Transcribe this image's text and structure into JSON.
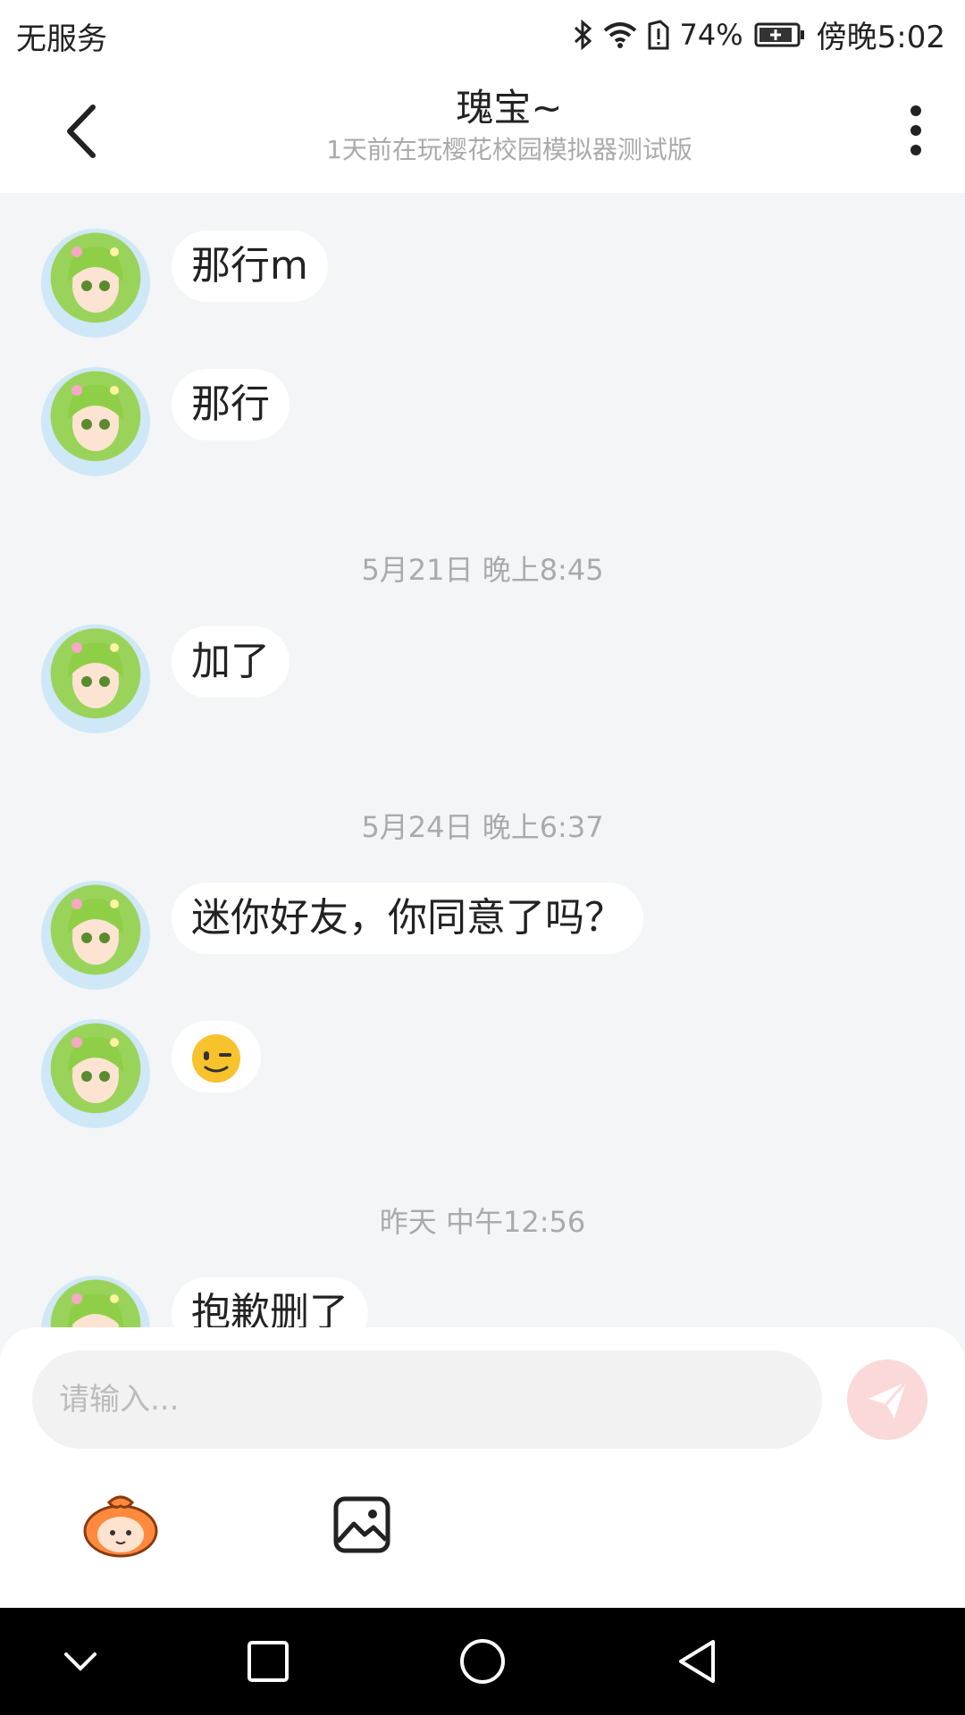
{
  "status_bar": {
    "carrier": "无服务",
    "battery_percent": "74%",
    "time": "傍晚5:02",
    "icons": [
      "bluetooth-icon",
      "wifi-icon",
      "sim-alert-icon",
      "battery-charging-icon"
    ]
  },
  "header": {
    "title": "瑰宝~",
    "subtitle": "1天前在玩樱花校园模拟器测试版"
  },
  "messages": [
    {
      "type": "text",
      "text": "那行m"
    },
    {
      "type": "text",
      "text": "那行"
    },
    {
      "type": "time",
      "text": "5月21日 晚上8:45"
    },
    {
      "type": "text",
      "text": "加了"
    },
    {
      "type": "time",
      "text": "5月24日 晚上6:37"
    },
    {
      "type": "text",
      "text": "迷你好友，你同意了吗？"
    },
    {
      "type": "emoji",
      "emoji": "wink-emoji"
    },
    {
      "type": "time",
      "text": "昨天 中午12:56"
    },
    {
      "type": "text",
      "text": "抱歉删了"
    }
  ],
  "input": {
    "placeholder": "请输入..."
  },
  "colors": {
    "chat_bg": "#f4f5f7",
    "send_button": "#fcd9d9",
    "accent": "#ff8a3d"
  }
}
